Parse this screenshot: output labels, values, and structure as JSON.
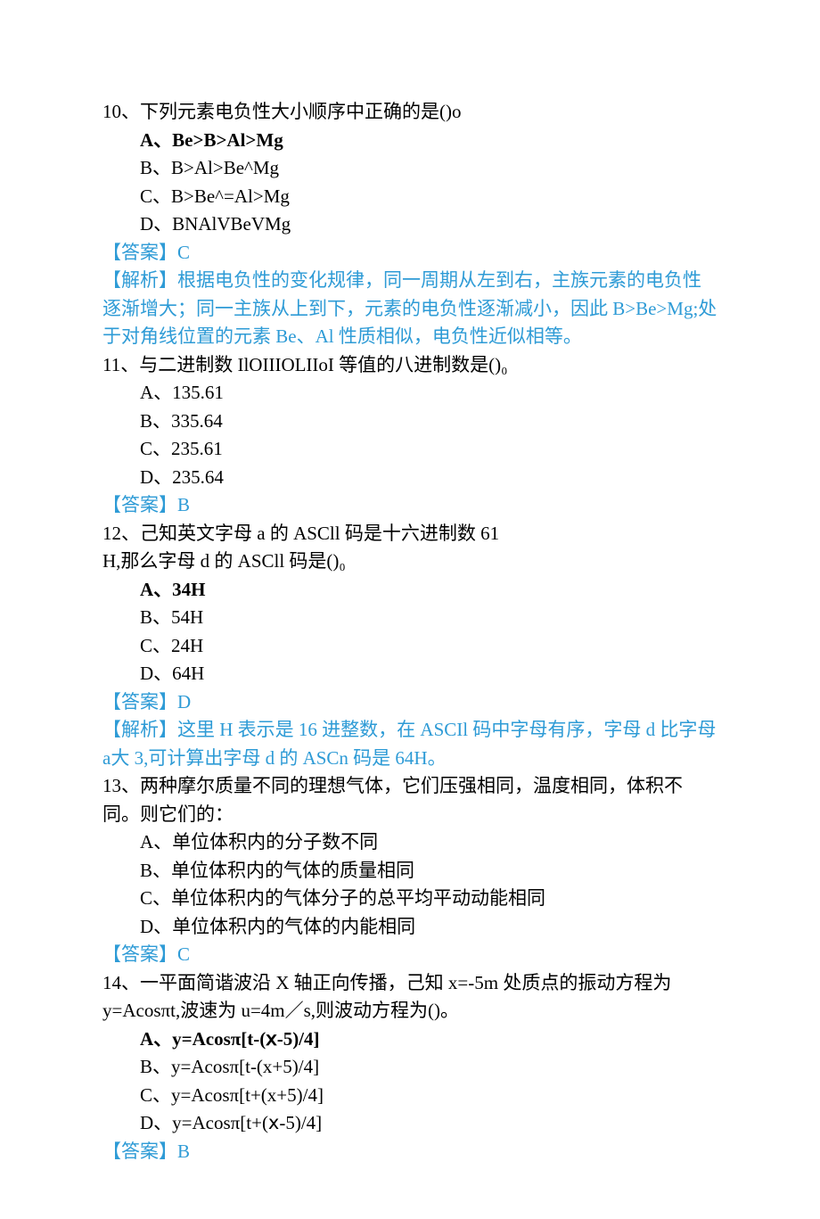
{
  "q10": {
    "stem": "10、下列元素电负性大小顺序中正确的是()o",
    "optA": "A、Be>B>Al>Mg",
    "optB": "B、B>Al>Be^Mg",
    "optC": "C、B>Be^=Al>Mg",
    "optD": "D、BNAlVBeVMg",
    "answer": "C",
    "explanation": "根据电负性的变化规律，同一周期从左到右，主族元素的电负性逐渐增大；同一主族从上到下，元素的电负性逐渐减小，因此 B>Be>Mg;处于对角线位置的元素 Be、Al 性质相似，电负性近似相等。"
  },
  "q11": {
    "stem": "11、与二进制数 IlOIIIOLIIoI 等值的八进制数是()₀",
    "optA": "A、135.61",
    "optB": "B、335.64",
    "optC": "C、235.61",
    "optD": "D、235.64",
    "answer": "B"
  },
  "q12": {
    "stem1": "12、己知英文字母 a 的 ASCll 码是十六进制数 61",
    "stem2": "H,那么字母 d 的 ASCll 码是()₀",
    "optA": "A、34H",
    "optB": "B、54H",
    "optC": "C、24H",
    "optD": "D、64H",
    "answer": "D",
    "explanation": "这里 H 表示是 16 进整数，在 ASCIl 码中字母有序，字母 d 比字母 a大 3,可计算出字母 d 的 ASCn 码是 64H。"
  },
  "q13": {
    "stem": "13、两种摩尔质量不同的理想气体，它们压强相同，温度相同，体积不同。则它们的：",
    "optA": "A、单位体积内的分子数不同",
    "optB": "B、单位体积内的气体的质量相同",
    "optC": "C、单位体积内的气体分子的总平均平动动能相同",
    "optD": "D、单位体积内的气体的内能相同",
    "answer": "C"
  },
  "q14": {
    "stem1": "14、一平面简谐波沿 X 轴正向传播，己知 x=-5m 处质点的振动方程为",
    "stem2": "y=Acosπt,波速为 u=4m／s,则波动方程为()。",
    "optA": "A、y=Acosπ[t-(ⅹ-5)/4]",
    "optB": "B、y=Acosπ[t-(x+5)/4]",
    "optC": "C、y=Acosπ[t+(x+5)/4]",
    "optD": "D、y=Acosπ[t+(ⅹ-5)/4]",
    "answer": "B"
  }
}
